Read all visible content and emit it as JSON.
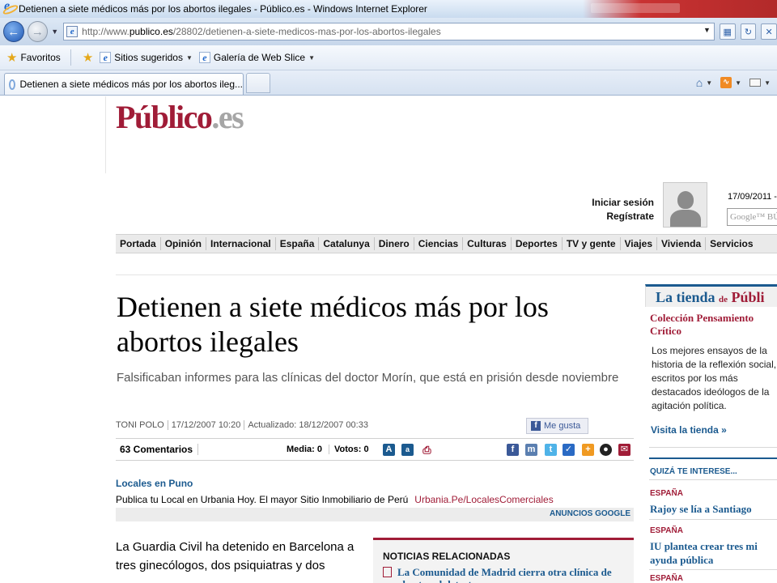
{
  "window": {
    "title": "Detienen a siete médicos más por los abortos ilegales - Público.es - Windows Internet Explorer"
  },
  "address": {
    "prefix": "http://www.",
    "host": "publico.es",
    "path": "/28802/detienen-a-siete-medicos-mas-por-los-abortos-ilegales"
  },
  "favorites": {
    "favorites_label": "Favoritos",
    "suggested_label": "Sitios sugeridos",
    "webslice_label": "Galería de Web Slice"
  },
  "tabs": [
    {
      "label": "Detienen a siete médicos más por los abortos ileg..."
    }
  ],
  "site": {
    "logo_brand": "Público",
    "logo_tld": ".es",
    "login_label": "Iniciar sesión",
    "register_label": "Regístrate",
    "date": "17/09/2011 -",
    "search_placeholder": "Google™ BÚ"
  },
  "nav": [
    "Portada",
    "Opinión",
    "Internacional",
    "España",
    "Catalunya",
    "Dinero",
    "Ciencias",
    "Culturas",
    "Deportes",
    "TV y gente",
    "Viajes",
    "Vivienda",
    "Servicios"
  ],
  "article": {
    "headline": "Detienen a siete médicos más por los abortos ilegales",
    "subheadline": "Falsificaban informes para las clínicas del doctor Morín, que está en prisión desde noviembre",
    "author": "TONI POLO",
    "published": "17/12/2007 10:20",
    "updated": "Actualizado: 18/12/2007 00:33",
    "fb_like": "Me gusta",
    "comments": "63 Comentarios",
    "media": "Media: 0",
    "votes": "Votos: 0",
    "body_start": "La Guardia Civil ha detenido en Barcelona a tres ginecólogos, dos psiquiatras y dos"
  },
  "ad": {
    "title": "Locales en Puno",
    "text": "Publica tu Local en Urbania Hoy. El mayor Sitio Inmobiliario de Perú",
    "url": "Urbania.Pe/LocalesComerciales",
    "label": "ANUNCIOS GOOGLE"
  },
  "related": {
    "title": "NOTICIAS RELACIONADAS",
    "first_item": "La Comunidad de Madrid cierra otra clínica de abortos al detectar"
  },
  "sidebar": {
    "store_title_a": "La tienda",
    "store_title_de": "de",
    "store_title_b": "Públi",
    "collection": "Colección Pensamiento Crítico",
    "description": "Los mejores ensayos de la historia de la reflexión social, escritos por los más destacados ideólogos de la agitación política.",
    "store_link": "Visita la tienda »",
    "quiza": "QUIZÁ TE INTERESE...",
    "items": [
      {
        "category": "ESPAÑA",
        "headline": "Rajoy se lía a Santiago"
      },
      {
        "category": "ESPAÑA",
        "headline": "IU plantea crear tres mi",
        "headline2": "ayuda pública"
      },
      {
        "category": "ESPAÑA",
        "headline": ""
      }
    ]
  }
}
